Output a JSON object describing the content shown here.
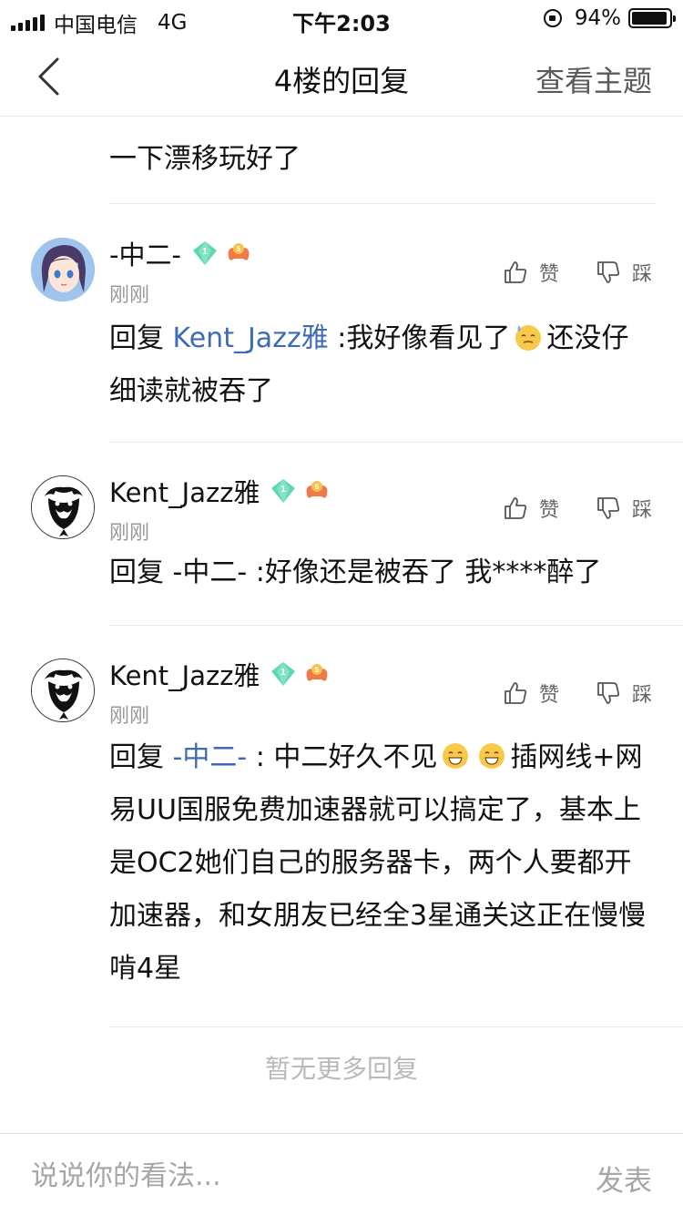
{
  "status_bar": {
    "carrier": "中国电信",
    "network": "4G",
    "time": "下午2:03",
    "battery": "94%",
    "battery_level": 0.94
  },
  "nav": {
    "title": "4楼的回复",
    "action": "查看主题"
  },
  "prior_tail": {
    "line": "一下漂移玩好了"
  },
  "replies": [
    {
      "username": "-中二-",
      "gem_level": "1",
      "game_level": "5",
      "time": "刚刚",
      "like_label": "赞",
      "dislike_label": "踩",
      "prefix": "回复 ",
      "mention": "Kent_Jazz雅",
      "text_a": " :我好像看见了",
      "text_b": "还没仔细读就被吞了"
    },
    {
      "username": "Kent_Jazz雅",
      "gem_level": "1",
      "game_level": "5",
      "time": "刚刚",
      "like_label": "赞",
      "dislike_label": "踩",
      "text": "回复 -中二- :好像还是被吞了 我****醉了"
    },
    {
      "username": "Kent_Jazz雅",
      "gem_level": "1",
      "game_level": "5",
      "time": "刚刚",
      "like_label": "赞",
      "dislike_label": "踩",
      "prefix": "回复 ",
      "mention": "-中二-",
      "text_a": " : 中二好久不见",
      "text_b": "插网线+网易UU国服免费加速器就可以搞定了，基本上是OC2她们自己的服务器卡，两个人要都开加速器，和女朋友已经全3星通关这正在慢慢啃4星"
    }
  ],
  "end_message": "暂无更多回复",
  "bottom_bar": {
    "placeholder": "说说你的看法...",
    "publish": "发表"
  },
  "colors": {
    "mention": "#3d6bb5",
    "gem": "#5fd6b2",
    "game_badge": "#f07a4a"
  }
}
